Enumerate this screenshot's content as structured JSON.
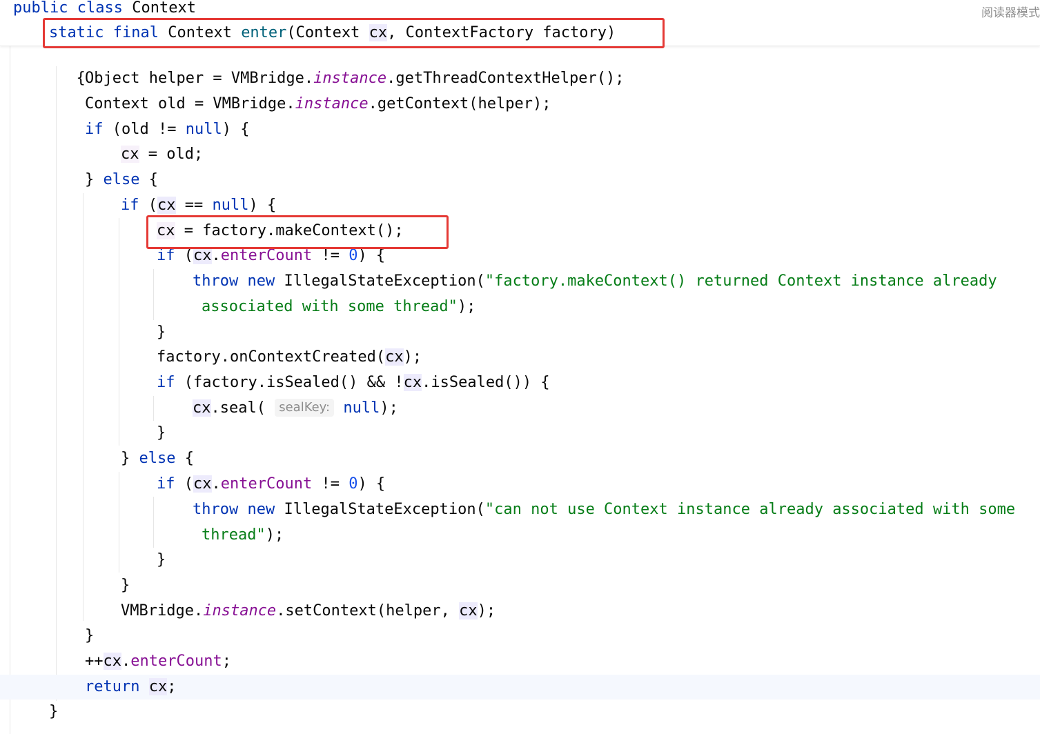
{
  "reader_mode_label": "阅读器模式",
  "sticky_header": {
    "line1": {
      "kw1": "public",
      "kw2": "class",
      "name": "Context"
    },
    "line2": {
      "kw1": "static",
      "kw2": "final",
      "type": "Context",
      "method": "enter",
      "p1_type": "(Context ",
      "p1": "cx",
      "p2": ", ContextFactory factory)"
    }
  },
  "code": {
    "open_brace": "{",
    "l1": {
      "a": "Object helper = VMBridge.",
      "inst": "instance",
      "b": ".getThreadContextHelper();"
    },
    "l2": {
      "a": "Context old = VMBridge.",
      "inst": "instance",
      "b": ".getContext(helper);"
    },
    "l3": {
      "kw": "if",
      "a": " (old != ",
      "null": "null",
      "b": ") {"
    },
    "l4": {
      "cx": "cx",
      "b": " = old;"
    },
    "l5": {
      "a": "} ",
      "kw": "else",
      "b": " {"
    },
    "l6": {
      "kw": "if",
      "a": " (",
      "cx": "cx",
      "b": " == ",
      "null": "null",
      "c": ") {"
    },
    "l7": {
      "cx": "cx",
      "b": " = factory.makeContext();"
    },
    "l8": {
      "kw": "if",
      "a": " (",
      "cx": "cx",
      "dot": ".",
      "field": "enterCount",
      "b": " != ",
      "num": "0",
      "c": ") {"
    },
    "l9": {
      "kw1": "throw",
      "kw2": "new",
      "a": " IllegalStateException(",
      "str": "\"factory.makeContext() returned Context instance already"
    },
    "l10": {
      "str": "associated with some thread\"",
      "b": ");"
    },
    "l11": {
      "a": "}"
    },
    "l12": {
      "a": "factory.onContextCreated(",
      "cx": "cx",
      "b": ");"
    },
    "l13": {
      "kw": "if",
      "a": " (factory.isSealed() && !",
      "cx": "cx",
      "b": ".isSealed()) {"
    },
    "l14": {
      "cx": "cx",
      "a": ".seal( ",
      "hint": "sealKey:",
      "null": "null",
      "b": ");"
    },
    "l15": {
      "a": "}"
    },
    "l16": {
      "a": "} ",
      "kw": "else",
      "b": " {"
    },
    "l17": {
      "kw": "if",
      "a": " (",
      "cx": "cx",
      "dot": ".",
      "field": "enterCount",
      "b": " != ",
      "num": "0",
      "c": ") {"
    },
    "l18": {
      "kw1": "throw",
      "kw2": "new",
      "a": " IllegalStateException(",
      "str": "\"can not use Context instance already associated with some"
    },
    "l19": {
      "str": "thread\"",
      "b": ");"
    },
    "l20": {
      "a": "}"
    },
    "l21": {
      "a": "}"
    },
    "l22": {
      "a": "VMBridge.",
      "inst": "instance",
      "b": ".setContext(helper, ",
      "cx": "cx",
      "c": ");"
    },
    "l23": {
      "a": "}"
    },
    "l24": {
      "a": "++",
      "cx": "cx",
      "dot": ".",
      "field": "enterCount",
      "b": ";"
    },
    "l25": {
      "kw": "return",
      "cx": "cx",
      "b": ";"
    },
    "l26": {
      "a": "}"
    }
  },
  "colors": {
    "keyword": "#0033b3",
    "method": "#00627a",
    "field": "#871094",
    "string": "#067d17",
    "number": "#1750eb",
    "annotation_box": "#e53935"
  }
}
